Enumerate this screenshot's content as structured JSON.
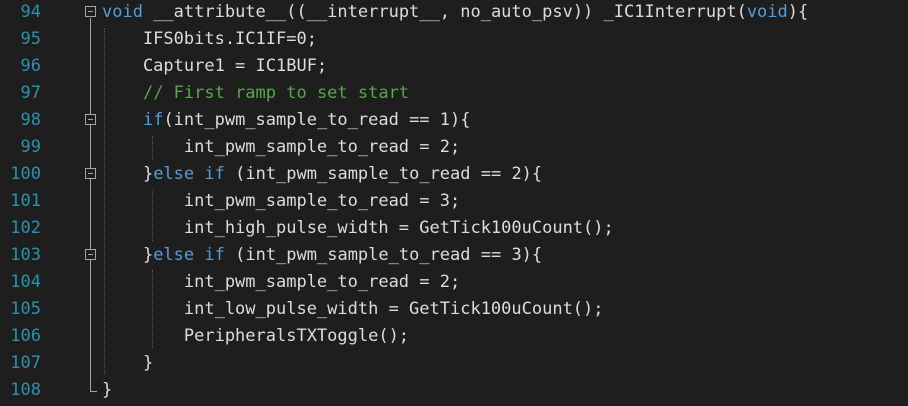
{
  "editor": {
    "lines": [
      {
        "number": "94",
        "fold": true,
        "segments": [
          {
            "type": "kw",
            "text": "void"
          },
          {
            "type": "tx",
            "text": " __attribute__((__interrupt__, no_auto_psv)) _IC1Interrupt("
          },
          {
            "type": "kw",
            "text": "void"
          },
          {
            "type": "tx",
            "text": "){"
          }
        ]
      },
      {
        "number": "95",
        "fold": false,
        "segments": [
          {
            "type": "tx",
            "text": "    IFS0bits.IC1IF=0;"
          }
        ]
      },
      {
        "number": "96",
        "fold": false,
        "segments": [
          {
            "type": "tx",
            "text": "    Capture1 = IC1BUF;"
          }
        ]
      },
      {
        "number": "97",
        "fold": false,
        "segments": [
          {
            "type": "tx",
            "text": "    "
          },
          {
            "type": "cm",
            "text": "// First ramp to set start"
          }
        ]
      },
      {
        "number": "98",
        "fold": true,
        "segments": [
          {
            "type": "tx",
            "text": "    "
          },
          {
            "type": "kw",
            "text": "if"
          },
          {
            "type": "tx",
            "text": "(int_pwm_sample_to_read == 1){"
          }
        ]
      },
      {
        "number": "99",
        "fold": false,
        "segments": [
          {
            "type": "tx",
            "text": "        int_pwm_sample_to_read = 2;"
          }
        ]
      },
      {
        "number": "100",
        "fold": true,
        "segments": [
          {
            "type": "tx",
            "text": "    }"
          },
          {
            "type": "kw",
            "text": "else"
          },
          {
            "type": "tx",
            "text": " "
          },
          {
            "type": "kw",
            "text": "if"
          },
          {
            "type": "tx",
            "text": " (int_pwm_sample_to_read == 2){"
          }
        ]
      },
      {
        "number": "101",
        "fold": false,
        "segments": [
          {
            "type": "tx",
            "text": "        int_pwm_sample_to_read = 3;"
          }
        ]
      },
      {
        "number": "102",
        "fold": false,
        "segments": [
          {
            "type": "tx",
            "text": "        int_high_pulse_width = GetTick100uCount();"
          }
        ]
      },
      {
        "number": "103",
        "fold": true,
        "segments": [
          {
            "type": "tx",
            "text": "    }"
          },
          {
            "type": "kw",
            "text": "else"
          },
          {
            "type": "tx",
            "text": " "
          },
          {
            "type": "kw",
            "text": "if"
          },
          {
            "type": "tx",
            "text": " (int_pwm_sample_to_read == 3){"
          }
        ]
      },
      {
        "number": "104",
        "fold": false,
        "segments": [
          {
            "type": "tx",
            "text": "        int_pwm_sample_to_read = 2;"
          }
        ]
      },
      {
        "number": "105",
        "fold": false,
        "segments": [
          {
            "type": "tx",
            "text": "        int_low_pulse_width = GetTick100uCount();"
          }
        ]
      },
      {
        "number": "106",
        "fold": false,
        "segments": [
          {
            "type": "tx",
            "text": "        PeripheralsTXToggle();"
          }
        ]
      },
      {
        "number": "107",
        "fold": false,
        "segments": [
          {
            "type": "tx",
            "text": "    }"
          }
        ]
      },
      {
        "number": "108",
        "fold": false,
        "segments": [
          {
            "type": "tx",
            "text": "}"
          }
        ]
      }
    ]
  },
  "colors": {
    "background": "#1e1e1e",
    "line_number": "#2b91af",
    "keyword": "#569cd6",
    "comment": "#57a64a",
    "text": "#dcdcdc"
  },
  "icons": {
    "fold": "collapse-box-minus"
  }
}
